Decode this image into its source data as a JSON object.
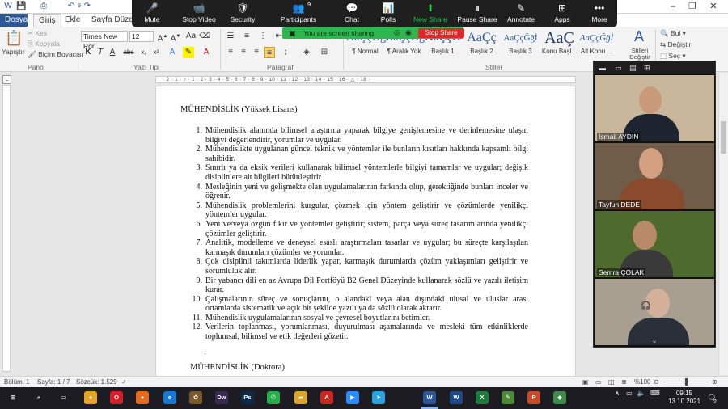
{
  "titlebar": {
    "quick_access": [
      "save-icon",
      "undo-icon",
      "redo-icon"
    ],
    "undo_count": "9",
    "window_buttons": [
      "–",
      "❐",
      "✕"
    ]
  },
  "ribbon_tabs": [
    {
      "label": "Dosya",
      "name": "tab-file"
    },
    {
      "label": "Giriş",
      "name": "tab-home"
    },
    {
      "label": "Ekle",
      "name": "tab-insert"
    },
    {
      "label": "Sayfa Düzeni",
      "name": "tab-page-layout"
    }
  ],
  "ribbon": {
    "clipboard": {
      "paste": "Yapıştır",
      "cut": "Kes",
      "copy": "Kopyala",
      "format_painter": "Biçim Boyacısı",
      "group": "Pano"
    },
    "font": {
      "family": "Times New Ror",
      "size": "12",
      "group": "Yazı Tipi"
    },
    "paragraph": {
      "group": "Paragraf"
    },
    "styles": {
      "group": "Stiller",
      "items": [
        {
          "preview": "AaÇçĞğİ",
          "label": "¶ Normal"
        },
        {
          "preview": "AaÇçĞğİ",
          "label": "¶ Aralık Yok"
        },
        {
          "preview": "AaÇçĞ",
          "label": "Başlık 1"
        },
        {
          "preview": "AaÇç",
          "label": "Başlık 2"
        },
        {
          "preview": "AaÇçĞğİ",
          "label": "Başlık 3"
        },
        {
          "preview": "AaÇ",
          "label": "Konu Başl..."
        },
        {
          "preview": "AaÇçĞğİ",
          "label": "Alt Konu ..."
        }
      ],
      "change_styles": "Stilleri Değiştir"
    },
    "editing": {
      "find": "Bul",
      "replace": "Değiştir",
      "select": "Seç"
    }
  },
  "zoom_toolbar": {
    "buttons": [
      {
        "label": "Mute",
        "icon": "🎤",
        "name": "zoom-mute-button"
      },
      {
        "label": "Stop Video",
        "icon": "📹",
        "name": "zoom-stop-video-button"
      },
      {
        "label": "Security",
        "icon": "🛡",
        "name": "zoom-security-button"
      },
      {
        "label": "Participants",
        "icon": "👥",
        "name": "zoom-participants-button"
      },
      {
        "label": "Chat",
        "icon": "💬",
        "name": "zoom-chat-button"
      },
      {
        "label": "Polls",
        "icon": "📊",
        "name": "zoom-polls-button"
      },
      {
        "label": "New Share",
        "icon": "⬆",
        "name": "zoom-new-share-button"
      },
      {
        "label": "Pause Share",
        "icon": "⏸",
        "name": "zoom-pause-share-button"
      },
      {
        "label": "Annotate",
        "icon": "✎",
        "name": "zoom-annotate-button"
      },
      {
        "label": "Apps",
        "icon": "⊞",
        "name": "zoom-apps-button"
      },
      {
        "label": "More",
        "icon": "•••",
        "name": "zoom-more-button"
      }
    ],
    "participant_count": "9",
    "sharing_banner": "You are screen sharing",
    "stop_share": "Stop Share"
  },
  "ruler": {
    "marks": "· 2 · 1 · ▿ · 1 · 2 · 3 · 4 · 5 · 6 · 7 · 8 · 9 · 10 · 11 · 12 · 13 · 14 · 15 · 16 · △ · 18 ·"
  },
  "document": {
    "heading1": "MÜHENDİSLİK  (Yüksek Lisans)",
    "items": [
      {
        "num": "1.",
        "text": "Mühendislik alanında bilimsel araştırma yaparak bilgiye genişlemesine ve derinlemesine ulaşır, bilgiyi değerlendirir, yorumlar ve uygular."
      },
      {
        "num": "2.",
        "text": "Mühendislikte uygulanan güncel teknik ve yöntemler ile bunların kısıtları hakkında kapsamlı bilgi sahibidir."
      },
      {
        "num": "3.",
        "text": "Sınırlı ya da eksik verileri kullanarak bilimsel yöntemlerle bilgiyi tamamlar ve uygular; değişik disiplinlere ait bilgileri bütünleştirir"
      },
      {
        "num": "4.",
        "text": "Mesleğinin yeni ve gelişmekte olan uygulamalarının farkında olup, gerektiğinde bunları inceler ve öğrenir."
      },
      {
        "num": "5.",
        "text": "Mühendislik problemlerini kurgular, çözmek için yöntem geliştirir ve çözümlerde yenilikçi yöntemler uygular."
      },
      {
        "num": "6.",
        "text": "Yeni ve/veya özgün fikir ve yöntemler geliştirir; sistem, parça veya süreç tasarımlarında yenilikçi çözümler geliştirir."
      },
      {
        "num": "7.",
        "text": "Analitik, modelleme ve deneysel esaslı araştırmaları tasarlar ve uygular; bu süreçte karşılaşılan karmaşık durumları çözümler ve yorumlar."
      },
      {
        "num": "8.",
        "text": "Çok disiplinli takımlarda liderlik yapar, karmaşık durumlarda çözüm yaklaşımları geliştirir ve sorumluluk alır."
      },
      {
        "num": "9.",
        "text": "Bir yabancı dili en az Avrupa Dil Portföyü B2 Genel Düzeyinde kullanarak sözlü ve yazılı iletişim kurar."
      },
      {
        "num": "10.",
        "text": "Çalışmalarının süreç ve sonuçlarını, o alandaki veya alan dışındaki ulusal ve uluslar arası ortamlarda sistematik ve açık bir şekilde yazılı ya da sözlü olarak aktarır."
      },
      {
        "num": "11.",
        "text": "Mühendislik uygulamalarının sosyal ve çevresel boyutlarını betimler."
      },
      {
        "num": "12.",
        "text": "Verilerin toplanması, yorumlanması, duyurulması aşamalarında ve mesleki tüm etkinliklerde toplumsal, bilimsel ve etik değerleri gözetir."
      }
    ],
    "heading2": "MÜHENDİSLİK (Doktora)"
  },
  "video_panel": {
    "participants": [
      {
        "name": "İsmail AYDIN",
        "bg": "#c9b79c",
        "skin": "#c89a7a",
        "shirt": "#1d2430"
      },
      {
        "name": "Tayfun DEDE",
        "bg": "#6f5d4a",
        "skin": "#d2a080",
        "shirt": "#8a4a2c"
      },
      {
        "name": "Semra ÇOLAK",
        "bg": "#4e6a2c",
        "skin": "#b98a6a",
        "shirt": "#3a3a3a"
      },
      {
        "name": "",
        "bg": "#a89f90",
        "skin": "#d4b09a",
        "shirt": "#2b2f3a"
      }
    ],
    "chevron": "⌄"
  },
  "status_bar": {
    "section": "Bölüm: 1",
    "page": "Sayfa: 1 / 7",
    "words": "Sözcük: 1.529",
    "zoom": "%100"
  },
  "taskbar": {
    "apps": [
      {
        "name": "start-icon",
        "label": "⊞",
        "color": "#1c1c22"
      },
      {
        "name": "search-icon",
        "label": "⌕",
        "color": "#1c1c22"
      },
      {
        "name": "task-view-icon",
        "label": "▭",
        "color": "#1c1c22"
      },
      {
        "name": "chrome-icon",
        "label": "●",
        "color": "#e8a628"
      },
      {
        "name": "opera-icon",
        "label": "O",
        "color": "#d3202b"
      },
      {
        "name": "firefox-icon",
        "label": "●",
        "color": "#e56b1f"
      },
      {
        "name": "edge-icon",
        "label": "e",
        "color": "#1b78d1"
      },
      {
        "name": "paint-icon",
        "label": "✿",
        "color": "#7a5a2a"
      },
      {
        "name": "dreamweaver-icon",
        "label": "Dw",
        "color": "#3a2b55"
      },
      {
        "name": "photoshop-icon",
        "label": "Ps",
        "color": "#0c2a4a"
      },
      {
        "name": "whatsapp-icon",
        "label": "✆",
        "color": "#25b04a"
      },
      {
        "name": "explorer-icon",
        "label": "▰",
        "color": "#d9a82a"
      },
      {
        "name": "acrobat-icon",
        "label": "A",
        "color": "#c6281f"
      },
      {
        "name": "zoom-app-icon",
        "label": "▶",
        "color": "#2d8cff"
      },
      {
        "name": "telegram-icon",
        "label": "➤",
        "color": "#2aa3df"
      },
      {
        "name": "word-running-icon",
        "label": "W",
        "color": "#2b579a"
      },
      {
        "name": "word-icon",
        "label": "W",
        "color": "#1f4a8a"
      },
      {
        "name": "excel-icon",
        "label": "X",
        "color": "#1f7a3e"
      },
      {
        "name": "greenshot-icon",
        "label": "✎",
        "color": "#4c8a3a"
      },
      {
        "name": "powerpoint-icon",
        "label": "P",
        "color": "#c94a2a"
      },
      {
        "name": "misc-app-icon",
        "label": "◆",
        "color": "#3f8c4a"
      }
    ],
    "time": "09:15",
    "date": "13.10.2021",
    "notifications": "2"
  }
}
